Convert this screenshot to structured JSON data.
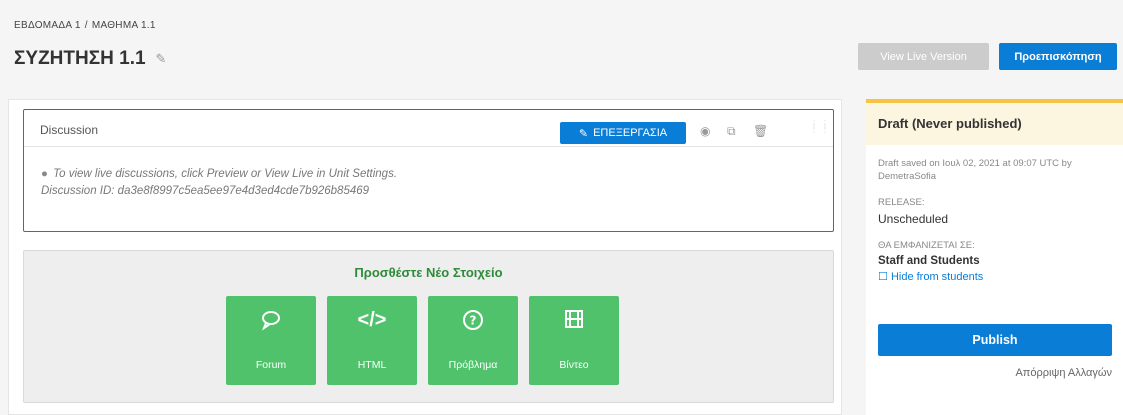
{
  "breadcrumb": {
    "week": "ΕΒΔΟΜΑΔΑ 1",
    "separator": "/",
    "lesson": "ΜΑΘΗΜΑ 1.1"
  },
  "page": {
    "title": "ΣΥΖΗΤΗΣΗ 1.1"
  },
  "toolbar": {
    "view_live": "View Live Version",
    "preview": "Προεπισκόπηση"
  },
  "component": {
    "title": "Discussion",
    "edit_label": "ΕΠΕΞΕΡΓΑΣΙΑ",
    "line1": "To view live discussions, click Preview or View Live in Unit Settings.",
    "line2": "Discussion ID: da3e8f8997c5ea5ee97e4d3ed4cde7b926b85469"
  },
  "add_new": {
    "title": "Προσθέστε Νέο Στοιχείο",
    "buttons": [
      {
        "label": "Forum",
        "icon": "speech-bubble-icon"
      },
      {
        "label": "HTML",
        "icon": "code-icon"
      },
      {
        "label": "Πρόβλημα",
        "icon": "question-circle-icon"
      },
      {
        "label": "Βίντεο",
        "icon": "film-icon"
      }
    ]
  },
  "sidebar": {
    "status": "Draft (Never published)",
    "draft_info": "Draft saved on Ιουλ 02, 2021 at 09:07 UTC by DemetraSofia",
    "release_label": "RELEASE:",
    "release_value": "Unscheduled",
    "visible_label": "ΘΑ ΕΜΦΑΝΙΖΕΤΑΙ ΣΕ:",
    "visible_value": "Staff and Students",
    "hide_label": "Hide from students",
    "publish": "Publish",
    "discard": "Απόρριψη Αλλαγών"
  },
  "colors": {
    "accent": "#0a7dd6",
    "add_button": "#4fc26b",
    "draft_border": "#f6c344"
  }
}
